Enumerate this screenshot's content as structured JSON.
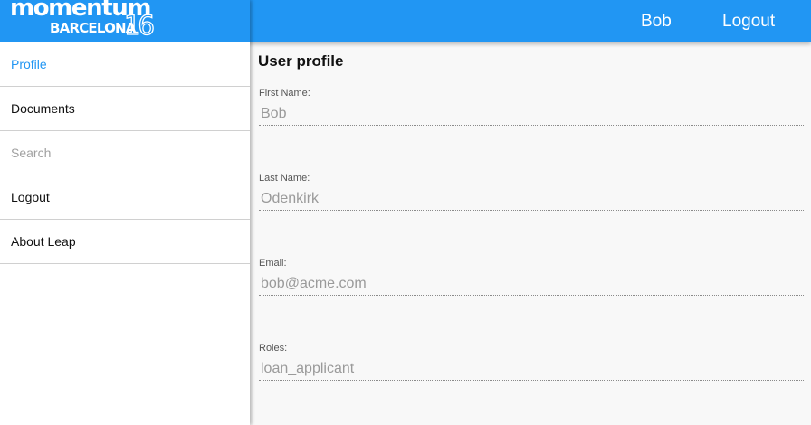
{
  "logo": {
    "word": "momentum",
    "city": "BARCELONA",
    "number": "16"
  },
  "topbar": {
    "user": "Bob",
    "logout": "Logout"
  },
  "menu": [
    {
      "label": "Profile",
      "state": "active"
    },
    {
      "label": "Documents",
      "state": "normal"
    },
    {
      "label": "Search",
      "state": "disabled"
    },
    {
      "label": "Logout",
      "state": "normal"
    },
    {
      "label": "About Leap",
      "state": "normal"
    }
  ],
  "page": {
    "title": "User profile"
  },
  "fields": [
    {
      "label": "First Name:",
      "value": "Bob"
    },
    {
      "label": "Last Name:",
      "value": "Odenkirk"
    },
    {
      "label": "Email:",
      "value": "bob@acme.com"
    },
    {
      "label": "Roles:",
      "value": "loan_applicant"
    }
  ],
  "colors": {
    "primary": "#2196f3",
    "content_bg": "#f8f8f8"
  }
}
